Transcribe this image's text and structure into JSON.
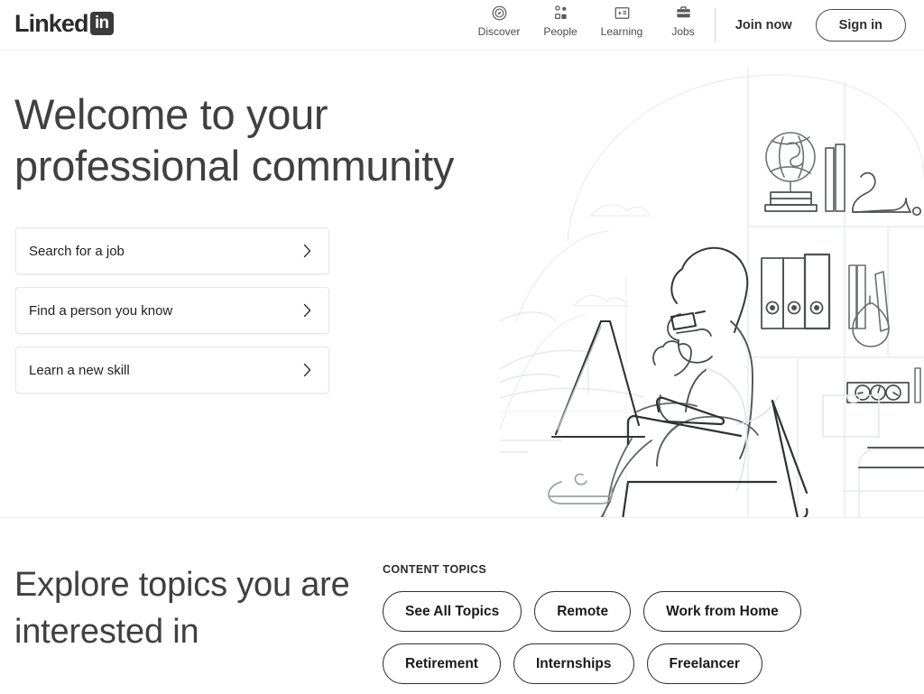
{
  "header": {
    "logo": {
      "word": "Linked",
      "box": "in",
      "icon": "linkedin-logo-icon"
    },
    "nav": [
      {
        "label": "Discover",
        "icon": "compass-icon"
      },
      {
        "label": "People",
        "icon": "people-group-icon"
      },
      {
        "label": "Learning",
        "icon": "learning-video-icon"
      },
      {
        "label": "Jobs",
        "icon": "briefcase-icon"
      }
    ],
    "join_now_label": "Join now",
    "sign_in_label": "Sign in"
  },
  "hero": {
    "headline": "Welcome to your professional community",
    "cta_cards": [
      {
        "label": "Search for a job",
        "chevron": "chevron-right-icon"
      },
      {
        "label": "Find a person you know",
        "chevron": "chevron-right-icon"
      },
      {
        "label": "Learn a new skill",
        "chevron": "chevron-right-icon"
      }
    ],
    "illustration": "person-sitting-with-laptop-line-art"
  },
  "topics": {
    "headline": "Explore topics you are interested in",
    "kicker": "CONTENT TOPICS",
    "rows": [
      [
        "See All Topics",
        "Remote",
        "Work from Home"
      ],
      [
        "Retirement",
        "Internships",
        "Freelancer"
      ]
    ]
  },
  "colors": {
    "background": "#ffffff",
    "text_primary": "#191919",
    "text_heading": "#404040",
    "border": "#e6e6e6",
    "pill_border": "#323232",
    "logo_box": "#3b3b3b"
  }
}
